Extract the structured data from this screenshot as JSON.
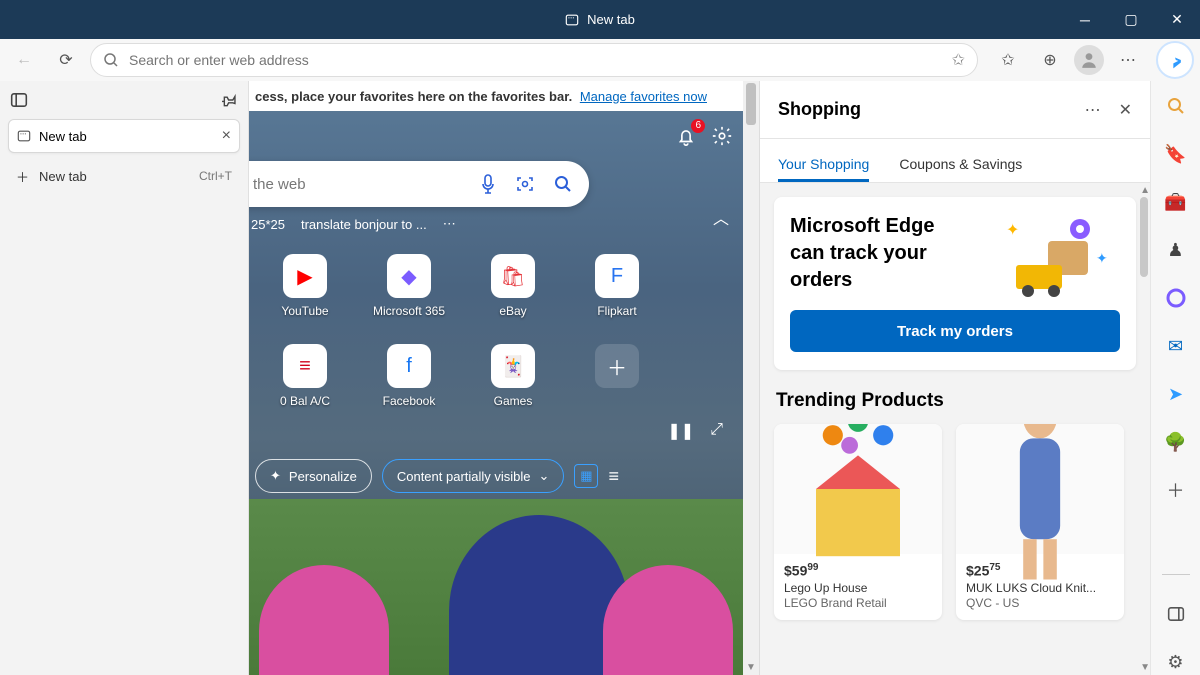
{
  "window": {
    "title": "New tab"
  },
  "toolbar": {
    "search_placeholder": "Search or enter web address"
  },
  "vtabs": {
    "active_tab": "New tab",
    "new_tab_label": "New tab",
    "new_tab_shortcut": "Ctrl+T"
  },
  "favbar": {
    "text_a": "cess, place your favorites here on the favorites bar.",
    "link": "Manage favorites now"
  },
  "ntp": {
    "search_hint": "the web",
    "quick1": "25*25",
    "quick2": "translate bonjour to ...",
    "notif_count": "6",
    "tiles": [
      {
        "label": "YouTube",
        "color": "#ff0000",
        "glyph": "▶"
      },
      {
        "label": "Microsoft 365",
        "color": "#7b5cff",
        "glyph": "◆"
      },
      {
        "label": "eBay",
        "color": "#e53238",
        "glyph": "🛍"
      },
      {
        "label": "Flipkart",
        "color": "#2874f0",
        "glyph": "F"
      },
      {
        "label": "0 Bal A/C",
        "color": "#d0021b",
        "glyph": "≡"
      },
      {
        "label": "Facebook",
        "color": "#1877f2",
        "glyph": "f"
      },
      {
        "label": "Games",
        "color": "#0a8f3c",
        "glyph": "🃏"
      }
    ],
    "personalize": "Personalize",
    "content_toggle": "Content partially visible"
  },
  "shopping": {
    "title": "Shopping",
    "tabs": {
      "your": "Your Shopping",
      "coupons": "Coupons & Savings"
    },
    "track_headline": "Microsoft Edge can track your orders",
    "track_button": "Track my orders",
    "trending_title": "Trending Products",
    "products": [
      {
        "price_main": "$59",
        "price_cents": "99",
        "name": "Lego Up House",
        "store": "LEGO Brand Retail"
      },
      {
        "price_main": "$25",
        "price_cents": "75",
        "name": "MUK LUKS Cloud Knit...",
        "store": "QVC - US"
      }
    ]
  },
  "rail_icons": [
    "search",
    "tag",
    "toolbox",
    "chess",
    "copilot",
    "outlook",
    "send",
    "tree",
    "plus",
    "panel",
    "settings"
  ]
}
